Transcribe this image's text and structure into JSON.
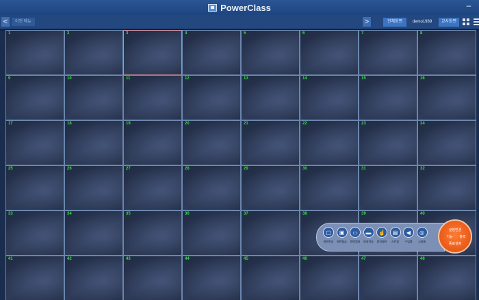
{
  "app": {
    "title": "PowerClass",
    "window_minimize_glyph": "–"
  },
  "toolbar": {
    "back_label": "이전 메뉴",
    "buttons": [
      "전체화면",
      "demo1989",
      "교사화면"
    ],
    "prev_glyph": "<",
    "next_glyph": ">"
  },
  "tiles": [
    "1",
    "2",
    "3",
    "4",
    "5",
    "6",
    "7",
    "8",
    "9",
    "10",
    "11",
    "12",
    "13",
    "14",
    "15",
    "16",
    "17",
    "18",
    "19",
    "20",
    "21",
    "22",
    "23",
    "24",
    "25",
    "26",
    "27",
    "28",
    "29",
    "30",
    "31",
    "32",
    "33",
    "34",
    "35",
    "36",
    "37",
    "38",
    "39",
    "40",
    "41",
    "42",
    "43",
    "44",
    "45",
    "46",
    "47",
    "48"
  ],
  "dock": {
    "items": [
      {
        "label": "화면전송",
        "icon": "monitor-icon",
        "glyph": "▢"
      },
      {
        "label": "화면잠금",
        "icon": "lock-icon",
        "glyph": "▣"
      },
      {
        "label": "화면캡처",
        "icon": "laptop-icon",
        "glyph": "▭"
      },
      {
        "label": "파일전송",
        "icon": "folder-icon",
        "glyph": "▬"
      },
      {
        "label": "원격제어",
        "icon": "hand-icon",
        "glyph": "☝"
      },
      {
        "label": "스트림",
        "icon": "stream-icon",
        "glyph": "▤"
      },
      {
        "label": "수업평",
        "icon": "speaker-icon",
        "glyph": "◀"
      },
      {
        "label": "시설물",
        "icon": "clock-icon",
        "glyph": "◎"
      }
    ],
    "orange_labels": [
      "설정변경",
      "기능",
      "출력",
      "종료설정"
    ]
  }
}
